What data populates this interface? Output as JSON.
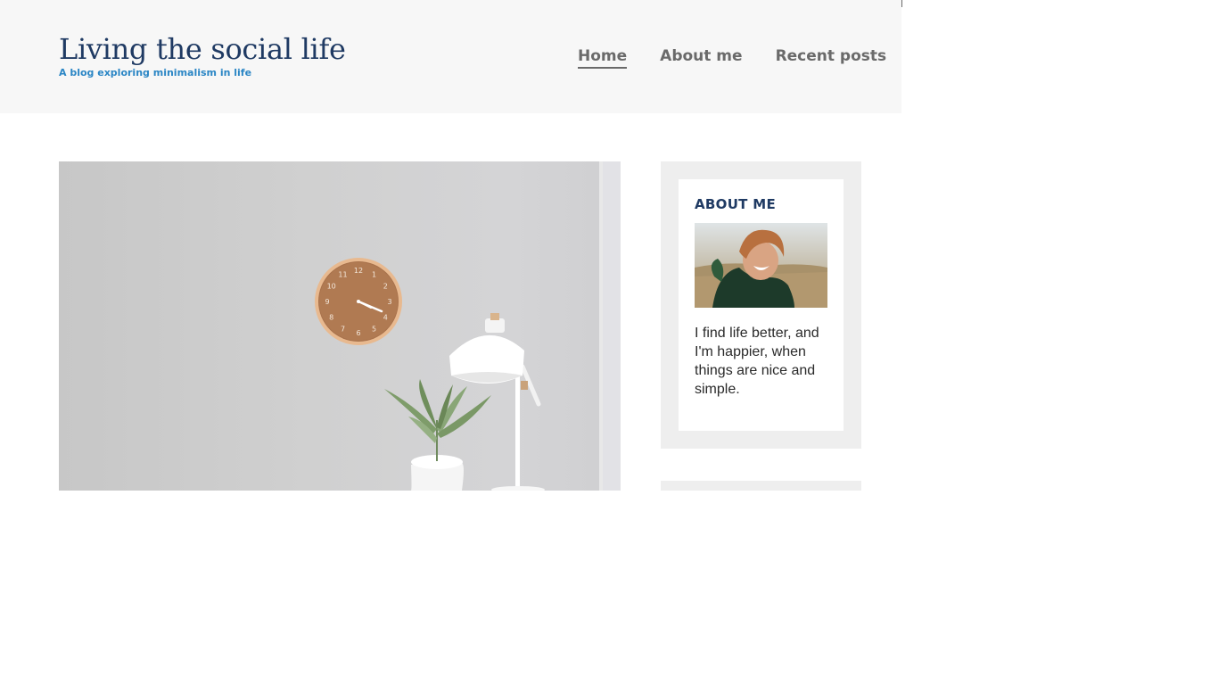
{
  "header": {
    "site_title": "Living the social life",
    "tagline": "A blog exploring minimalism in life"
  },
  "nav": {
    "items": [
      {
        "label": "Home",
        "active": true
      },
      {
        "label": "About me",
        "active": false
      },
      {
        "label": "Recent posts",
        "active": false
      }
    ]
  },
  "hero": {
    "image": "wall-clock-lamp-plant-photo",
    "clock_numbers": [
      "12",
      "1",
      "2",
      "3",
      "4",
      "5",
      "6",
      "7",
      "8",
      "9",
      "10",
      "11"
    ]
  },
  "sidebar": {
    "about": {
      "title": "ABOUT ME",
      "avatar": "smiling-person-photo",
      "text": "I find life better, and I'm happier, when things are nice and simple."
    }
  },
  "colors": {
    "title": "#1f3a63",
    "tagline": "#2b86c5",
    "nav": "#6a6a6a",
    "header_bg": "#f7f7f7",
    "widget_bg": "#eeeeee"
  }
}
